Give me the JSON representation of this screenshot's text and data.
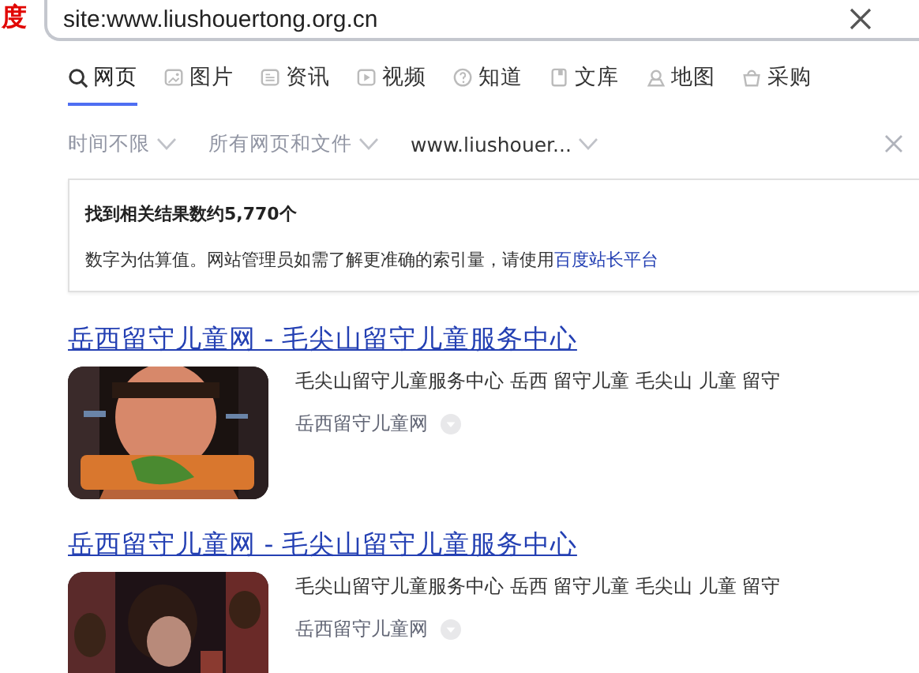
{
  "logo": "度",
  "search": {
    "value": "site:www.liushouertong.org.cn"
  },
  "tabs": [
    {
      "label": "网页",
      "selected": true
    },
    {
      "label": "图片",
      "selected": false
    },
    {
      "label": "资讯",
      "selected": false
    },
    {
      "label": "视频",
      "selected": false
    },
    {
      "label": "知道",
      "selected": false
    },
    {
      "label": "文库",
      "selected": false
    },
    {
      "label": "地图",
      "selected": false
    },
    {
      "label": "采购",
      "selected": false
    }
  ],
  "filters": [
    "时间不限",
    "所有网页和文件",
    "www.liushouer..."
  ],
  "info": {
    "count": "找到相关结果数约5,770个",
    "note": "数字为估算值。网站管理员如需了解更准确的索引量，请使用",
    "link": "百度站长平台"
  },
  "results": [
    {
      "title": "岳西留守儿童网 - 毛尖山留守儿童服务中心",
      "snippet": "毛尖山留守儿童服务中心 岳西 留守儿童 毛尖山 儿童 留守",
      "source": "岳西留守儿童网"
    },
    {
      "title": "岳西留守儿童网 - 毛尖山留守儿童服务中心",
      "snippet": "毛尖山留守儿童服务中心 岳西 留守儿童 毛尖山 儿童 留守",
      "source": "岳西留守儿童网"
    }
  ]
}
